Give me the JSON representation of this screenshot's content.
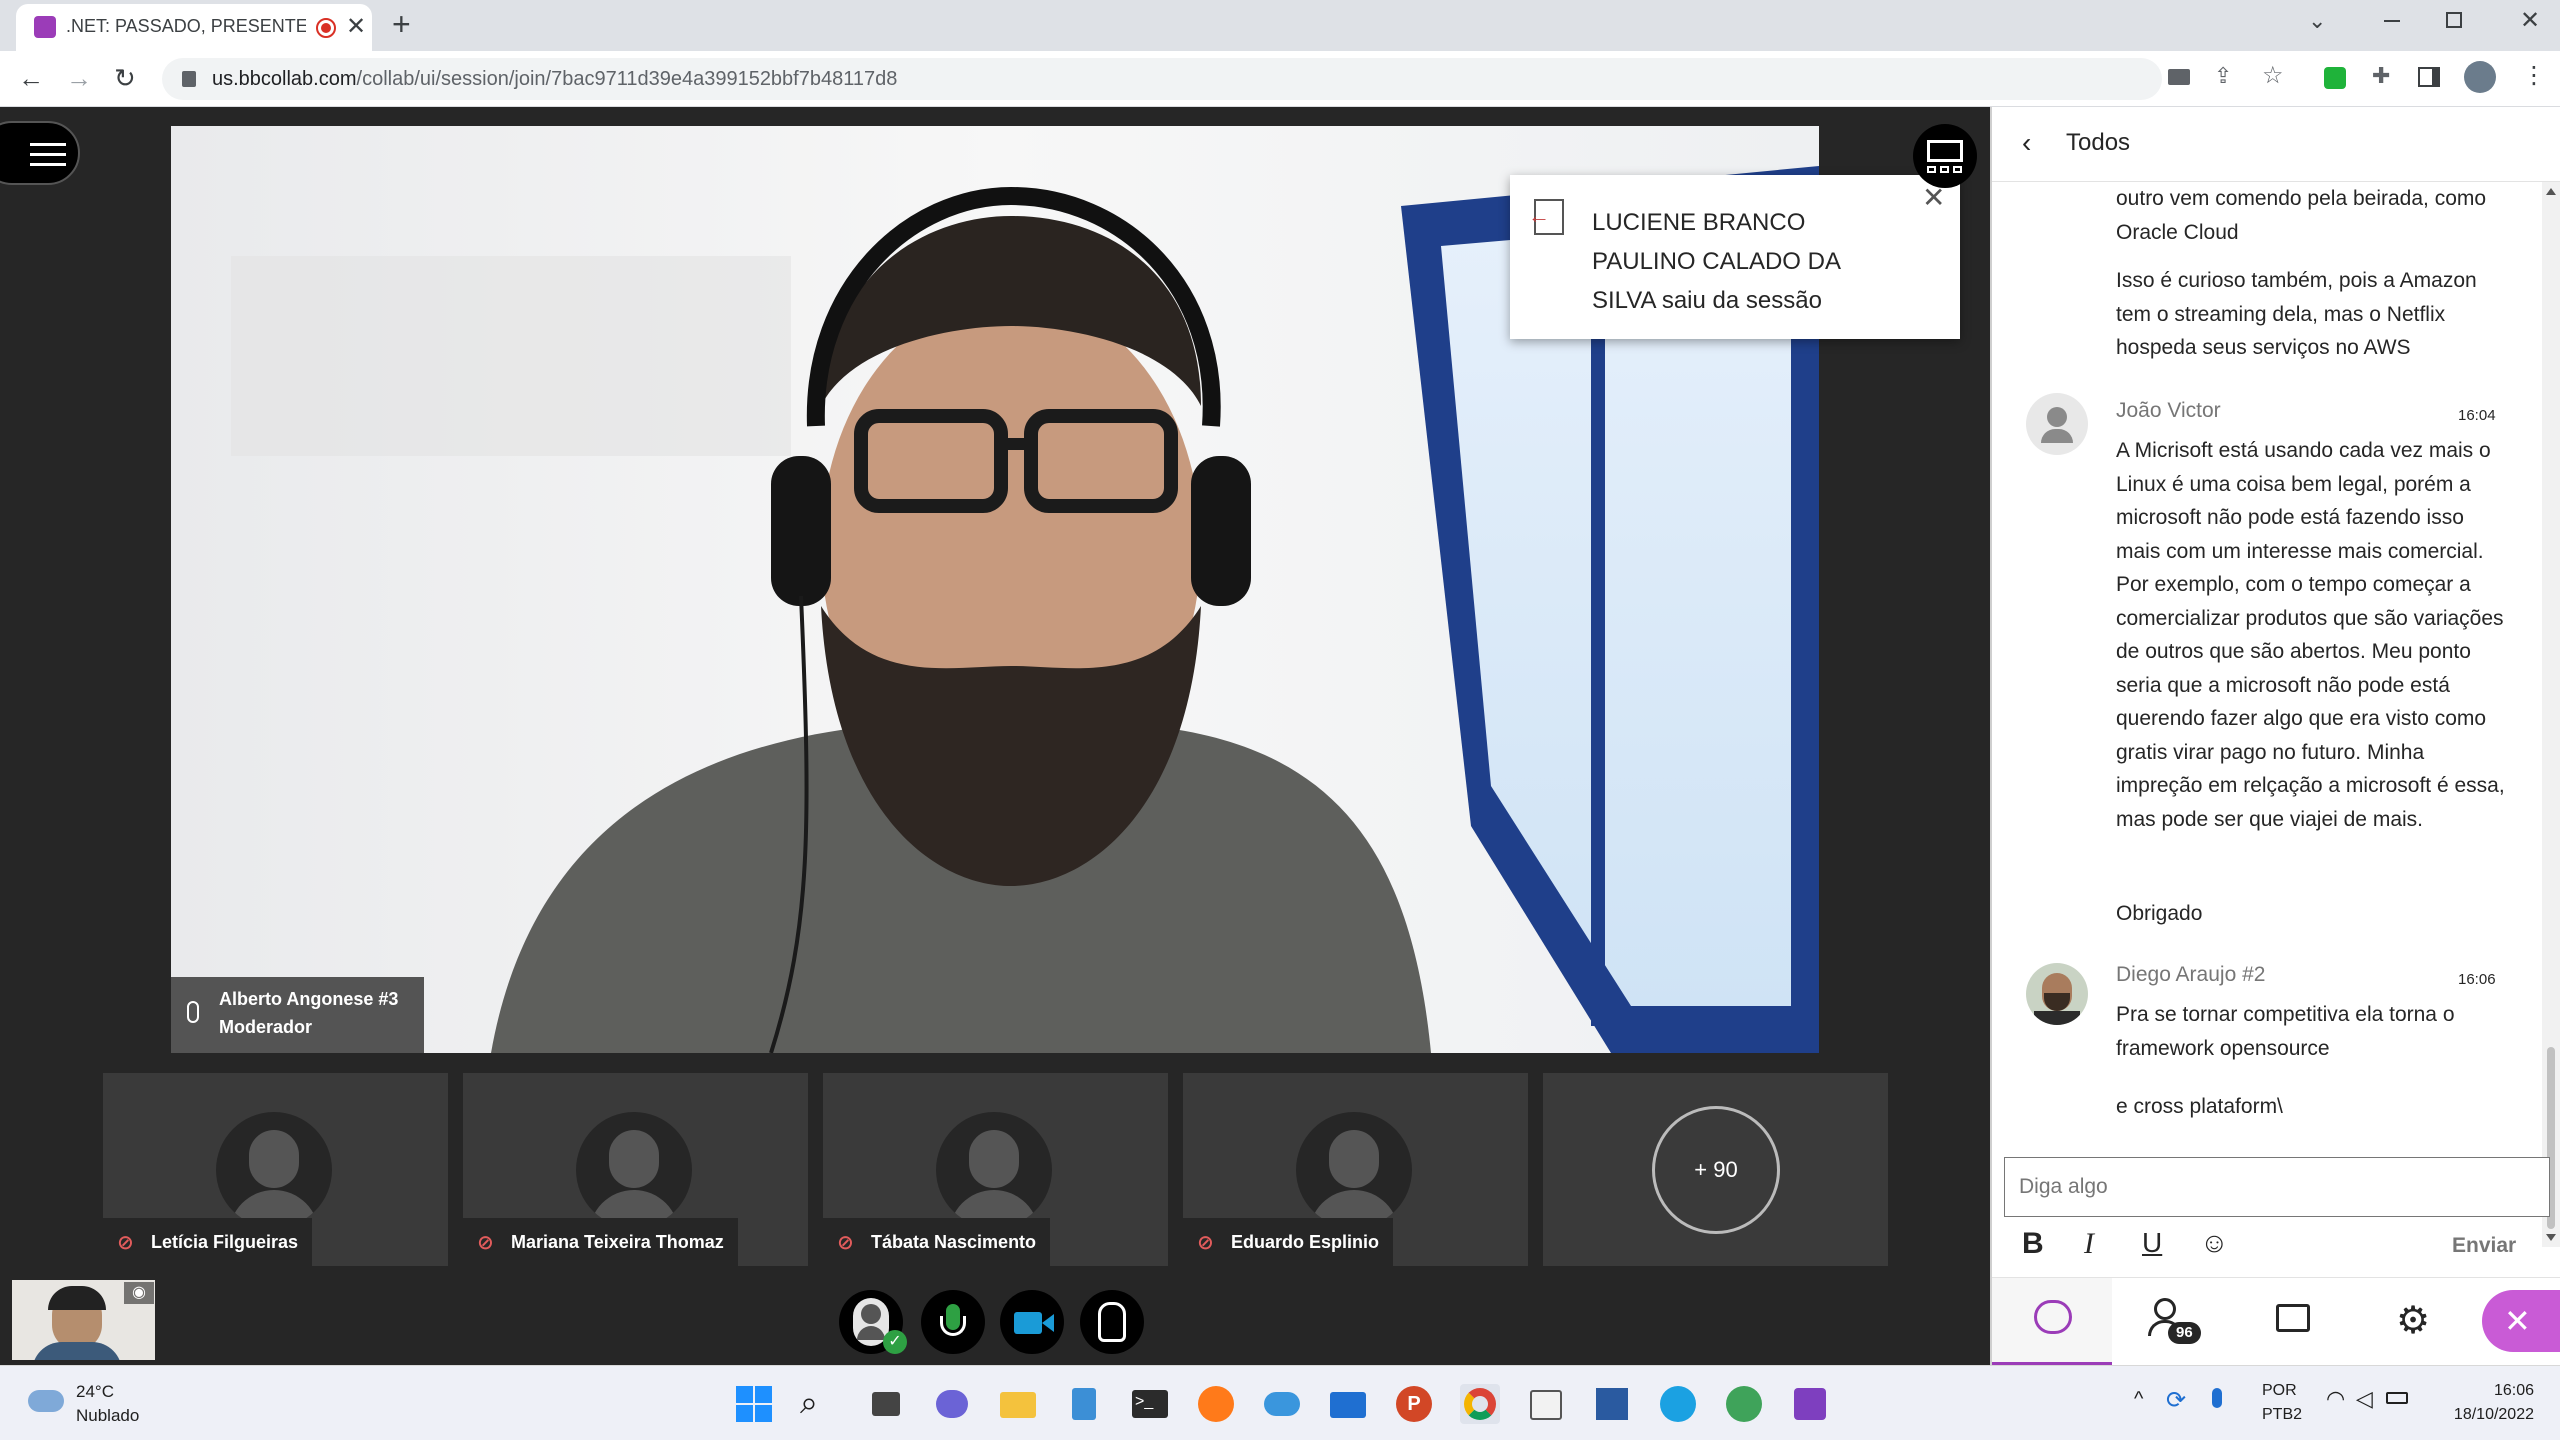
{
  "browser": {
    "tab_title": ".NET: PASSADO, PRESENTE, F",
    "url_host": "us.bbcollab.com",
    "url_path": "/collab/ui/session/join/7bac9711d39e4a399152bbf7b48117d8"
  },
  "speaker": {
    "name": "Alberto Angonese #3",
    "role": "Moderador"
  },
  "toast": {
    "message": "LUCIENE BRANCO PAULINO CALADO DA SILVA saiu da sessão"
  },
  "participants": [
    {
      "name": "Letícia Filgueiras"
    },
    {
      "name": "Mariana Teixeira Thomaz"
    },
    {
      "name": "Tábata Nascimento"
    },
    {
      "name": "Eduardo Esplinio"
    }
  ],
  "more_participants": "+ 90",
  "chat": {
    "header": "Todos",
    "partial_message": "outro vem comendo pela beirada, como Oracle Cloud",
    "partial_message_2": "Isso é curioso também, pois a Amazon tem o streaming dela, mas o Netflix hospeda seus serviços no AWS",
    "messages": [
      {
        "author": "João Victor",
        "time": "16:04",
        "text": "A Micrisoft está usando cada vez mais o Linux é uma coisa bem legal, porém a microsoft não pode está fazendo isso mais com um interesse mais comercial.  Por exemplo, com o tempo começar a comercializar produtos que são variações de outros que são abertos. Meu ponto seria que a microsoft não pode está querendo fazer algo que era visto como gratis virar pago no futuro.  Minha impreção em relçação a microsoft é essa, mas pode ser que viajei de mais.",
        "text2": "Obrigado"
      },
      {
        "author": "Diego Araujo #2",
        "time": "16:06",
        "text": "Pra se tornar competitiva ela torna o framework opensource",
        "text2": "e cross plataform\\"
      }
    ],
    "input_placeholder": "Diga algo",
    "send_label": "Enviar",
    "attendee_count": "96"
  },
  "taskbar": {
    "temperature": "24°C",
    "weather": "Nublado",
    "lang1": "POR",
    "lang2": "PTB2",
    "time": "16:06",
    "date": "18/10/2022"
  },
  "colors": {
    "accent": "#9b3cb8",
    "dark_bg": "#262626",
    "tile_bg": "#3a3a3a",
    "mic_green": "#2ea043",
    "camera_blue": "#1a9bd7"
  }
}
